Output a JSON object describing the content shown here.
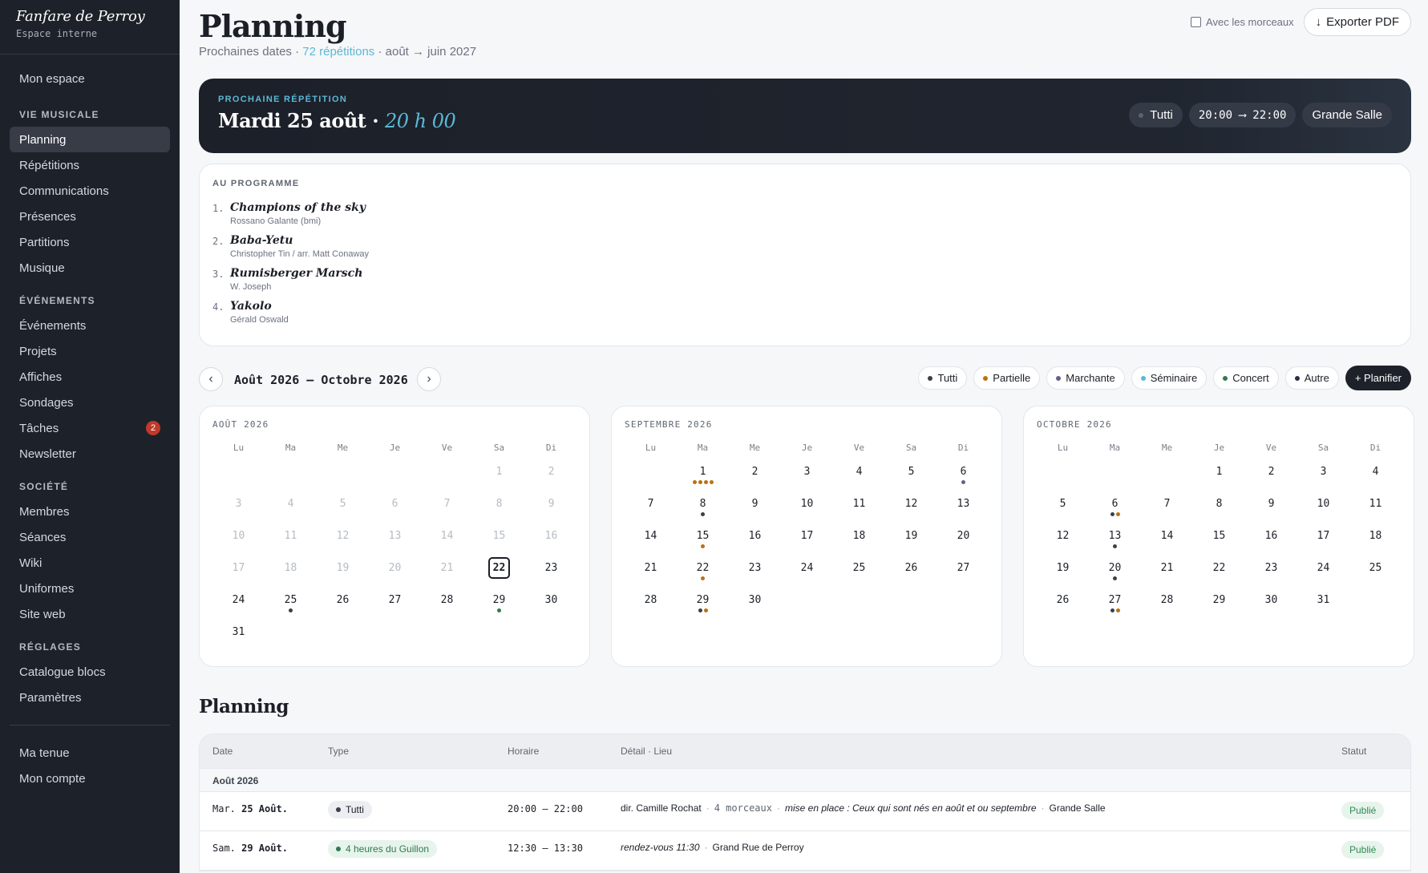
{
  "sidebar": {
    "brand_title": "Fanfare de Perroy",
    "brand_sub": "Espace interne",
    "top_item": "Mon espace",
    "sections": [
      {
        "title": "VIE MUSICALE",
        "items": [
          "Planning",
          "Répétitions",
          "Communications",
          "Présences",
          "Partitions",
          "Musique"
        ]
      },
      {
        "title": "ÉVÉNEMENTS",
        "items": [
          "Événements",
          "Projets",
          "Affiches",
          "Sondages",
          "Tâches",
          "Newsletter"
        ]
      },
      {
        "title": "SOCIÉTÉ",
        "items": [
          "Membres",
          "Séances",
          "Wiki",
          "Uniformes",
          "Site web"
        ]
      },
      {
        "title": "RÉGLAGES",
        "items": [
          "Catalogue blocs",
          "Paramètres"
        ]
      }
    ],
    "active_item": "Planning",
    "taches_badge": "2",
    "bottom_items": [
      "Ma tenue",
      "Mon compte"
    ]
  },
  "header": {
    "title": "Planning",
    "sub_prefix": "Prochaines dates · ",
    "sub_link": "72 répétitions",
    "sub_suffix": " · août → juin 2027",
    "checkbox_label": "Avec les morceaux",
    "export_label": "Exporter PDF",
    "export_icon": "arrow-down-icon"
  },
  "banner": {
    "kicker": "PROCHAINE RÉPÉTITION",
    "date": "Mardi 25 août · ",
    "time": "20 h 00",
    "tag_type": "Tutti",
    "tag_time": "20:00 ⟶ 22:00",
    "tag_place": "Grande Salle"
  },
  "program": {
    "title": "AU PROGRAMME",
    "pieces": [
      {
        "num": "1.",
        "name": "Champions of the sky",
        "composer": "Rossano Galante (bmi)"
      },
      {
        "num": "2.",
        "name": "Baba-Yetu",
        "composer": "Christopher Tin / arr. Matt Conaway"
      },
      {
        "num": "3.",
        "name": "Rumisberger Marsch",
        "composer": "W. Joseph"
      },
      {
        "num": "4.",
        "name": "Yakolo",
        "composer": "Gérald Oswald"
      }
    ]
  },
  "calendar": {
    "prev": "‹",
    "next": "›",
    "range": "Août 2026 – Octobre 2026",
    "legend": [
      {
        "label": "Tutti",
        "color": "#3a3f4a"
      },
      {
        "label": "Partielle",
        "color": "#b8730f"
      },
      {
        "label": "Marchante",
        "color": "#6b5f8a"
      },
      {
        "label": "Séminaire",
        "color": "#5bb8d6"
      },
      {
        "label": "Concert",
        "color": "#2f7a50"
      },
      {
        "label": "Autre",
        "color": "#2a2f45"
      }
    ],
    "add_label": "+ Planifier",
    "weekdays": [
      "Lu",
      "Ma",
      "Me",
      "Je",
      "Ve",
      "Sa",
      "Di"
    ],
    "months": [
      {
        "title": "AOÛT 2026",
        "leading_blanks": 5,
        "days": 31,
        "muted_until": 21,
        "today": 22,
        "events": {
          "25": [
            "#3a3f4a"
          ],
          "29": [
            "#2f7a50"
          ]
        }
      },
      {
        "title": "SEPTEMBRE 2026",
        "leading_blanks": 1,
        "days": 30,
        "muted_until": 0,
        "today": 0,
        "events": {
          "1": [
            "#b8730f",
            "#b8730f",
            "#b8730f",
            "#b8730f"
          ],
          "6": [
            "#6b5f8a"
          ],
          "8": [
            "#3a3f4a"
          ],
          "15": [
            "#b8730f"
          ],
          "22": [
            "#b8730f"
          ],
          "29": [
            "#3a3f4a",
            "#b8730f"
          ]
        }
      },
      {
        "title": "OCTOBRE 2026",
        "leading_blanks": 3,
        "days": 31,
        "muted_until": 0,
        "today": 0,
        "events": {
          "6": [
            "#3a3f4a",
            "#b8730f"
          ],
          "13": [
            "#3a3f4a"
          ],
          "20": [
            "#3a3f4a"
          ],
          "27": [
            "#3a3f4a",
            "#b8730f"
          ]
        }
      }
    ]
  },
  "planning": {
    "title": "Planning",
    "columns": [
      "Date",
      "Type",
      "Horaire",
      "Détail · Lieu",
      "Statut"
    ],
    "group": "Août 2026",
    "rows": [
      {
        "date_day": "Mar.",
        "date_rest": "25 Août.",
        "type": "Tutti",
        "type_bg": "#eceef1",
        "type_color": "#1b1f27",
        "type_dot": "#3a3f4a",
        "time": "20:00 – 22:00",
        "director": "dir. Camille Rochat",
        "pieces": "4 morceaux",
        "note": "mise en place : Ceux qui sont nés en août et ou septembre",
        "place": "Grande Salle",
        "status": "Publié"
      },
      {
        "date_day": "Sam.",
        "date_rest": "29 Août.",
        "type": "4 heures du Guillon",
        "type_bg": "#e7f4ec",
        "type_color": "#2f7a50",
        "type_dot": "#2f7a50",
        "time": "12:30 – 13:30",
        "note": "rendez-vous 11:30",
        "place": "Grand Rue de Perroy",
        "status": "Publié"
      }
    ]
  }
}
